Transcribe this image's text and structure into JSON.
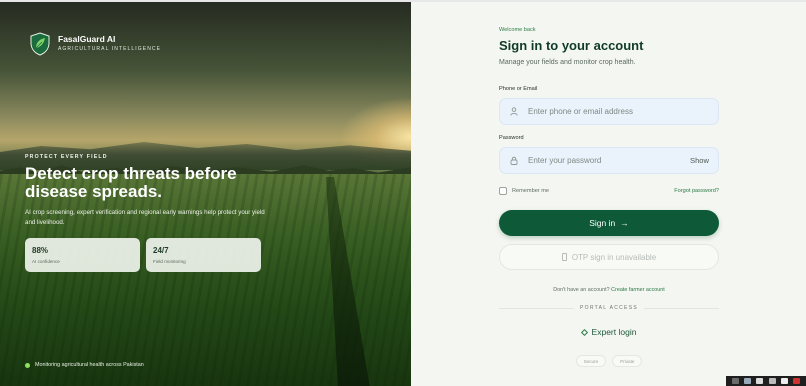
{
  "brand": {
    "name": "FasalGuard AI",
    "tagline": "AGRICULTURAL INTELLIGENCE"
  },
  "hero": {
    "kicker": "PROTECT EVERY FIELD",
    "headline": "Detect crop threats before disease spreads.",
    "description": "AI crop screening, expert verification and regional early warnings help protect your yield and livelihood.",
    "stats": [
      {
        "value": "88%",
        "label": "AI confidence"
      },
      {
        "value": "24/7",
        "label": "Field monitoring"
      }
    ],
    "status": "Monitoring agricultural health across Pakistan"
  },
  "signin": {
    "welcome": "Welcome back",
    "title": "Sign in to your account",
    "subtitle": "Manage your fields and monitor crop health.",
    "identifier_label": "Phone or Email",
    "identifier_placeholder": "Enter phone or email address",
    "password_label": "Password",
    "password_placeholder": "Enter your password",
    "show_label": "Show",
    "remember_label": "Remember me",
    "forgot_label": "Forgot password?",
    "submit_label": "Sign in",
    "submit_arrow": "→",
    "otp_label": "OTP sign in unavailable",
    "no_account_text": "Don't have an account?",
    "create_account_label": "Create farmer account",
    "portal_label": "PORTAL ACCESS",
    "expert_label": "Expert login",
    "chips": [
      "Secure",
      "Private"
    ]
  },
  "colors": {
    "primary": "#0e5a38",
    "accent": "#2a7a45",
    "status_dot": "#8fe05a"
  }
}
